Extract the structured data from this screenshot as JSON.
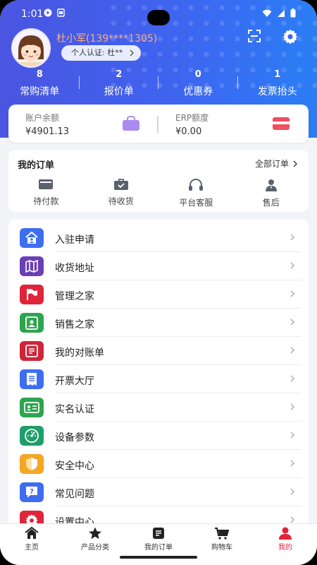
{
  "status": {
    "time": "1:01"
  },
  "profile": {
    "name": "杜小军(139****1305)",
    "certification": "个人认证: 杜**"
  },
  "stats": [
    {
      "count": "8",
      "label": "常购清单"
    },
    {
      "count": "2",
      "label": "报价单"
    },
    {
      "count": "0",
      "label": "优惠券"
    },
    {
      "count": "1",
      "label": "发票抬头"
    }
  ],
  "account": {
    "balance_label": "账户余额",
    "balance_value": "¥4901.13",
    "erp_label": "ERP额度",
    "erp_value": "¥0.00"
  },
  "orders": {
    "title": "我的订单",
    "all_label": "全部订单",
    "items": [
      {
        "label": "待付款",
        "icon": "wallet-icon"
      },
      {
        "label": "待收货",
        "icon": "briefcase-icon"
      },
      {
        "label": "平台客服",
        "icon": "headset-icon"
      },
      {
        "label": "售后",
        "icon": "person-icon"
      }
    ]
  },
  "menu": [
    {
      "label": "入驻申请",
      "icon": "store-icon",
      "color": "#3d6ef0"
    },
    {
      "label": "收货地址",
      "icon": "map-icon",
      "color": "#6a3fb3"
    },
    {
      "label": "管理之家",
      "icon": "flag-icon",
      "color": "#e0243a"
    },
    {
      "label": "销售之家",
      "icon": "badge-icon",
      "color": "#2ea44f"
    },
    {
      "label": "我的对账单",
      "icon": "ledger-icon",
      "color": "#d0243a"
    },
    {
      "label": "开票大厅",
      "icon": "receipt-icon",
      "color": "#3d6ef0"
    },
    {
      "label": "实名认证",
      "icon": "id-card-icon",
      "color": "#2ea44f"
    },
    {
      "label": "设备参数",
      "icon": "gauge-icon",
      "color": "#1f9e6a"
    },
    {
      "label": "安全中心",
      "icon": "shield-icon",
      "color": "#f5a623"
    },
    {
      "label": "常见问题",
      "icon": "question-icon",
      "color": "#3d6ef0"
    },
    {
      "label": "设置中心",
      "icon": "settings-icon",
      "color": "#e0243a"
    }
  ],
  "tabs": [
    {
      "label": "主页",
      "icon": "home-icon"
    },
    {
      "label": "产品分类",
      "icon": "star-icon"
    },
    {
      "label": "我的订单",
      "icon": "order-icon"
    },
    {
      "label": "购物车",
      "icon": "cart-icon"
    },
    {
      "label": "我的",
      "icon": "user-icon",
      "active": true
    }
  ]
}
